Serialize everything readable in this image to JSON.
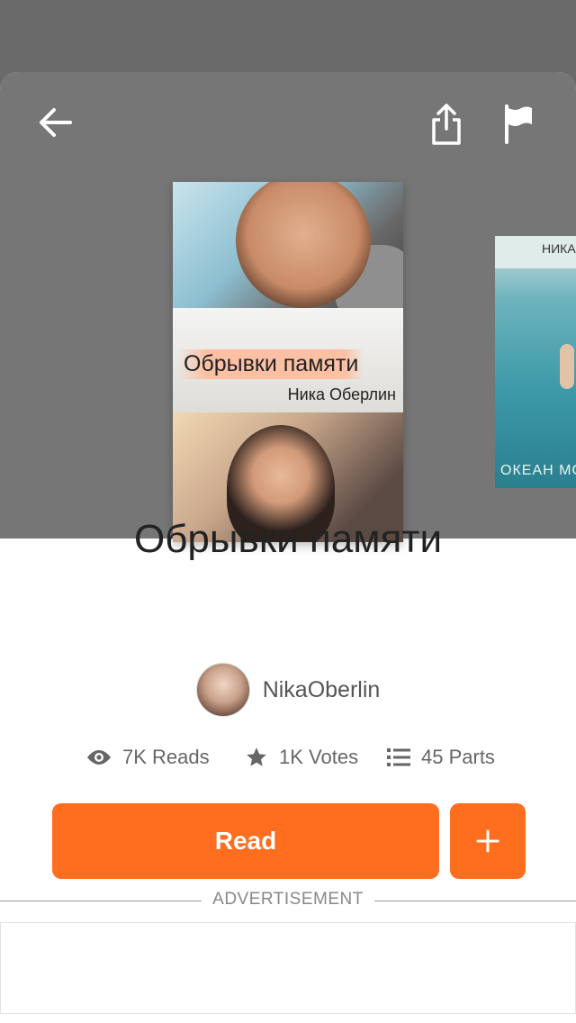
{
  "header": {
    "back_icon": "arrow-left-icon",
    "share_icon": "share-icon",
    "report_icon": "flag-icon"
  },
  "cover": {
    "title": "Обрывки памяти",
    "author": "Ника Оберлин"
  },
  "next_cover": {
    "author": "НИКА",
    "title": "ОКЕАН МОЕЙ"
  },
  "story": {
    "title": "Обрывки памяти",
    "author": "NikaOberlin"
  },
  "stats": {
    "reads": "7K Reads",
    "votes": "1K Votes",
    "parts": "45 Parts"
  },
  "actions": {
    "read_label": "Read",
    "add_icon": "plus-icon"
  },
  "ad": {
    "label": "ADVERTISEMENT"
  },
  "colors": {
    "accent": "#ff6d1f",
    "hero_bg": "#767676"
  }
}
